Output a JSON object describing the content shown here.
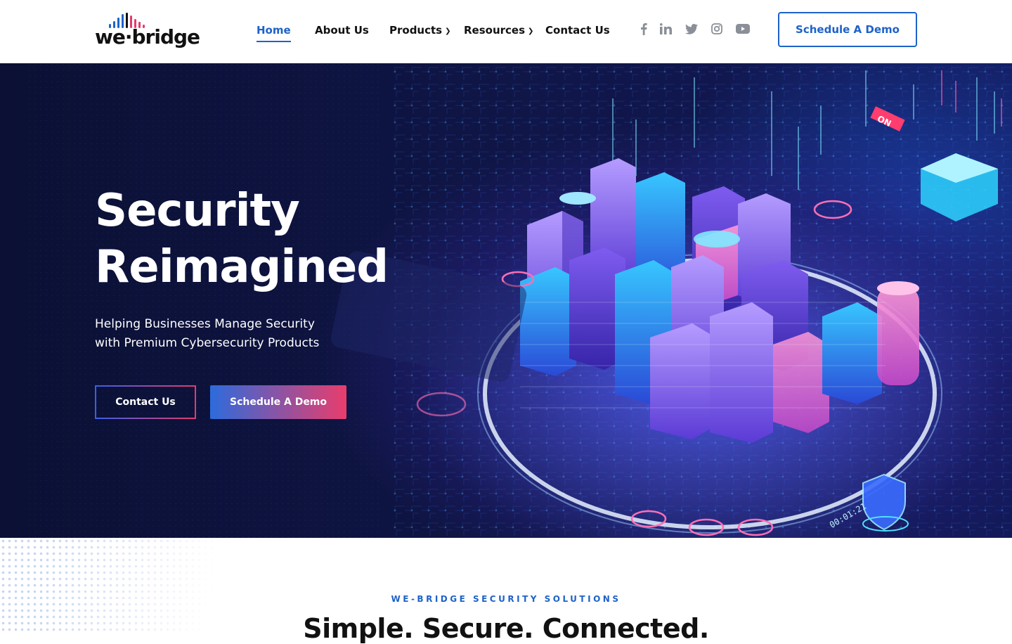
{
  "brand": {
    "logo_text": "we·bridge",
    "accent": "#1e62c9",
    "gradient_start": "#2d6bdc",
    "gradient_end": "#e93d6c"
  },
  "nav": {
    "home": "Home",
    "about": "About Us",
    "products": "Products",
    "resources": "Resources",
    "contact": "Contact Us"
  },
  "social": [
    "facebook-icon",
    "linkedin-icon",
    "twitter-icon",
    "instagram-icon",
    "youtube-icon"
  ],
  "header_cta": "Schedule A Demo",
  "hero": {
    "title_line1": "Security",
    "title_line2": "Reimagined",
    "subtitle_line1": "Helping Businesses Manage Security",
    "subtitle_line2": "with Premium Cybersecurity Products",
    "btn_contact": "Contact Us",
    "btn_demo": "Schedule A Demo",
    "art_label_on": "ON",
    "art_timer": "00:01:21"
  },
  "section": {
    "eyebrow": "WE-BRIDGE SECURITY SOLUTIONS",
    "title": "Simple. Secure. Connected."
  }
}
